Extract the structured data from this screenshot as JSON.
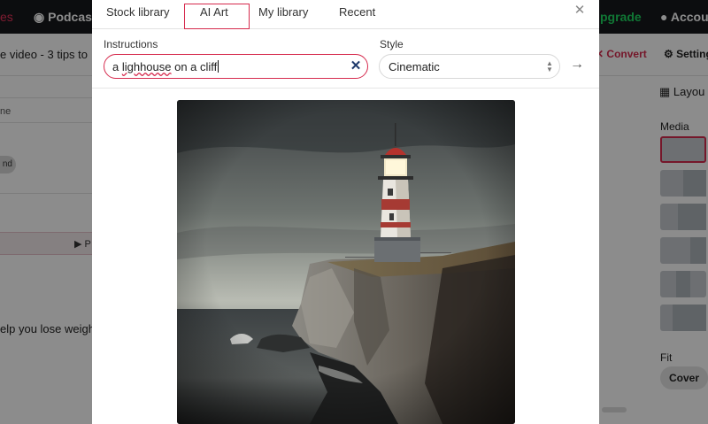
{
  "topbar": {
    "left_fragment": "es",
    "podcast": "Podcast",
    "upgrade": "pgrade",
    "account": "Accou"
  },
  "subbar": {
    "title": "e video - 3 tips to",
    "convert": "Convert",
    "settings": "Setting"
  },
  "left_panel": {
    "name_fragment": "ne",
    "chip": "nd",
    "play_fragment": "P",
    "text_fragment": "elp you lose weigh"
  },
  "right_panel": {
    "layout": "Layou",
    "media": "Media",
    "fit": "Fit",
    "cover": "Cover"
  },
  "modal": {
    "tabs": [
      {
        "label": "Stock library"
      },
      {
        "label": "AI Art",
        "active": true
      },
      {
        "label": "My library"
      },
      {
        "label": "Recent"
      }
    ],
    "close_icon": "close-icon",
    "instructions": {
      "label": "Instructions",
      "value_before": "a ",
      "value_misspelled": "lighhouse",
      "value_after": " on a cliff"
    },
    "style": {
      "label": "Style",
      "value": "Cinematic"
    },
    "accent_color": "#d62a4d",
    "result": {
      "alt": "a lighthouse on a cliff"
    }
  }
}
